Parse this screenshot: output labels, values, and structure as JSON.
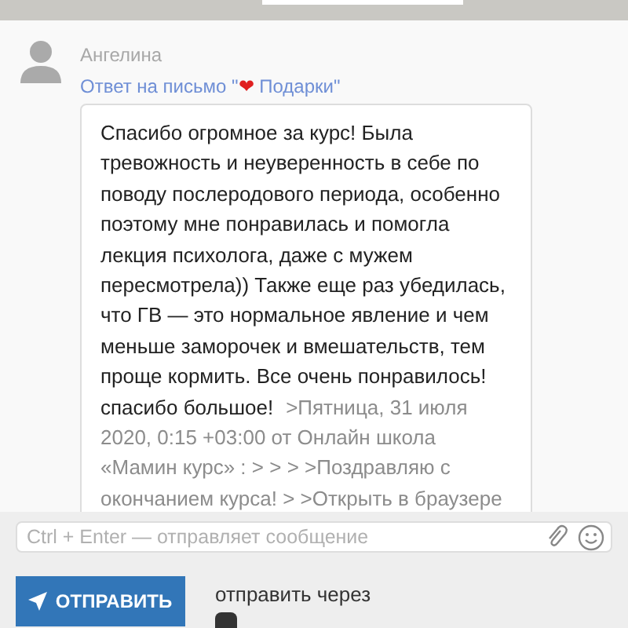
{
  "message": {
    "author": "Ангелина",
    "subject_prefix": "Ответ на письмо \"",
    "subject_heart": "❤",
    "subject_rest": " Подарки\"",
    "body": "Спасибо огромное за курс! Была тревожность и неуверенность в себе по поводу послеродового периода, особенно поэтому мне понравилась и помогла лекция психолога, даже с мужем пересмотрела)) Также еще раз убедилась, что ГВ — это нормальное явление и чем меньше заморочек и вмешательств, тем проще кормить. Все очень понравилось! спасибо большое!",
    "quote": ">Пятница, 31 июля 2020, 0:15 +03:00 от Онлайн школа «Мамин курс» : > > > >Поздравляю с окончанием курса! > >Открыть в браузере"
  },
  "composer": {
    "placeholder": "Ctrl + Enter — отправляет сообщение"
  },
  "send_button": "ОТПРАВИТЬ",
  "send_via": "отправить через"
}
